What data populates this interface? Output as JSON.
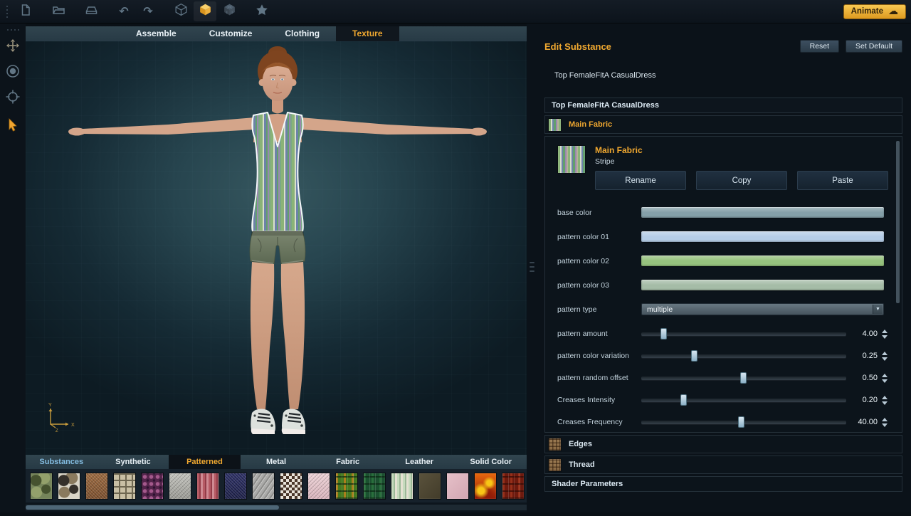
{
  "toolbar": {
    "icons": [
      {
        "name": "new-file"
      },
      {
        "name": "open-folder"
      },
      {
        "name": "save"
      },
      {
        "name": "undo"
      },
      {
        "name": "redo"
      },
      {
        "name": "cube-wireframe"
      },
      {
        "name": "cube-solid",
        "active": true
      },
      {
        "name": "cube-textured"
      },
      {
        "name": "favorites-star"
      }
    ],
    "animate": {
      "label": "Animate",
      "icon": "cloud-upload"
    }
  },
  "left_toolbar": {
    "tools": [
      "pan-tool",
      "orbit-tool",
      "zoom-target-tool",
      "select-cursor"
    ]
  },
  "viewport": {
    "tabs": [
      {
        "label": "Assemble",
        "active": false
      },
      {
        "label": "Customize",
        "active": false
      },
      {
        "label": "Clothing",
        "active": false
      },
      {
        "label": "Texture",
        "active": true
      }
    ],
    "axis_gizmo": {
      "x": "X",
      "y": "Y",
      "z": "Z"
    }
  },
  "edit_panel": {
    "title": "Edit Substance",
    "reset_label": "Reset",
    "set_default_label": "Set Default",
    "subtitle": "Top FemaleFitA CasualDress",
    "section_header": "Top FemaleFitA CasualDress",
    "main_fabric_accordion": "Main Fabric",
    "detail": {
      "title": "Main Fabric",
      "subtitle": "Stripe",
      "rename_label": "Rename",
      "copy_label": "Copy",
      "paste_label": "Paste"
    },
    "color_rows": [
      {
        "label": "base color",
        "color": "#85a0a9"
      },
      {
        "label": "pattern color 01",
        "color": "#b5cde7"
      },
      {
        "label": "pattern color 02",
        "color": "#96c27e"
      },
      {
        "label": "pattern color 03",
        "color": "#a5bca7"
      }
    ],
    "dropdown": {
      "label": "pattern type",
      "value": "multiple"
    },
    "sliders": [
      {
        "label": "pattern amount",
        "value": "4.00",
        "percent": 11
      },
      {
        "label": "pattern color variation",
        "value": "0.25",
        "percent": 26
      },
      {
        "label": "pattern random offset",
        "value": "0.50",
        "percent": 50
      },
      {
        "label": "Creases Intensity",
        "value": "0.20",
        "percent": 21
      },
      {
        "label": "Creases Frequency",
        "value": "40.00",
        "percent": 49
      }
    ],
    "collapsed_sections": [
      {
        "label": "Edges"
      },
      {
        "label": "Thread"
      }
    ],
    "shader_label": "Shader Parameters"
  },
  "library": {
    "tabs": [
      {
        "label": "Substances",
        "style": "link"
      },
      {
        "label": "Synthetic"
      },
      {
        "label": "Patterned",
        "active": true
      },
      {
        "label": "Metal"
      },
      {
        "label": "Fabric"
      },
      {
        "label": "Leather"
      },
      {
        "label": "Solid Color"
      }
    ],
    "swatches": [
      {
        "name": "camo-green",
        "pattern": "camo",
        "colors": [
          "#75845a",
          "#93a06b",
          "#46522f"
        ]
      },
      {
        "name": "camo-snow",
        "pattern": "camo",
        "colors": [
          "#d9d4c6",
          "#8a7a5e",
          "#35302a"
        ]
      },
      {
        "name": "tweed-brown",
        "pattern": "noise",
        "colors": [
          "#9c6a40",
          "#7a4e2c"
        ]
      },
      {
        "name": "windowpane-beige",
        "pattern": "grid",
        "colors": [
          "#c9bfa4",
          "#6e6650"
        ]
      },
      {
        "name": "damask-purple",
        "pattern": "damask",
        "colors": [
          "#53244a",
          "#a4598c",
          "#2c1230"
        ]
      },
      {
        "name": "textured-white",
        "pattern": "noise",
        "colors": [
          "#c4c4be",
          "#9a9a94"
        ]
      },
      {
        "name": "stripe-red",
        "pattern": "stripes-v",
        "colors": [
          "#b65a64",
          "#933c48",
          "#cf8a92"
        ]
      },
      {
        "name": "denim-navy",
        "pattern": "noise",
        "colors": [
          "#2c2f64",
          "#1b1e46"
        ]
      },
      {
        "name": "herringbone-gray",
        "pattern": "herringbone",
        "colors": [
          "#ababa9",
          "#8c8c8a",
          "#c9c9c7"
        ]
      },
      {
        "name": "houndstooth",
        "pattern": "check",
        "colors": [
          "#4a3629",
          "#e9e3d9"
        ]
      },
      {
        "name": "weave-pink",
        "pattern": "noise",
        "colors": [
          "#ecd2d6",
          "#d9b4bc"
        ]
      },
      {
        "name": "tartan-green-orange",
        "pattern": "tartan",
        "colors": [
          "#44791f",
          "#d8821c",
          "#173312"
        ]
      },
      {
        "name": "tartan-dark-green",
        "pattern": "tartan",
        "colors": [
          "#1b5130",
          "#2f7c42",
          "#0c2a16"
        ]
      },
      {
        "name": "stripe-pale-green",
        "pattern": "stripes-v",
        "colors": [
          "#c6dabd",
          "#9cb897",
          "#e5e1d2"
        ]
      },
      {
        "name": "canvas-olive",
        "pattern": "plain",
        "colors": [
          "#5a523c",
          "#423c2a"
        ]
      },
      {
        "name": "weave-rose",
        "pattern": "plain",
        "colors": [
          "#e6c0c8",
          "#d2a6b2"
        ]
      },
      {
        "name": "lava-orange",
        "pattern": "flame",
        "colors": [
          "#e8680e",
          "#f8c616",
          "#901c08"
        ]
      },
      {
        "name": "plaid-dark-red",
        "pattern": "tartan",
        "colors": [
          "#6e1a0e",
          "#a8381e",
          "#380c06"
        ]
      }
    ]
  },
  "colors": {
    "accent_orange": "#f0a830",
    "tab_bar": "#2e4250",
    "tab_active_bg": "#10171e",
    "panel_bg": "#0b1219",
    "link_blue": "#83bce0"
  }
}
